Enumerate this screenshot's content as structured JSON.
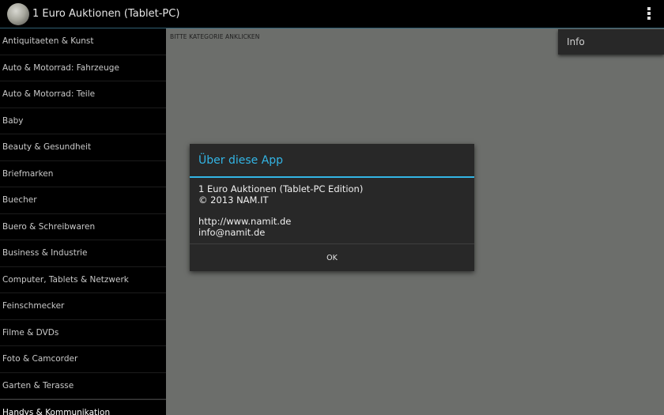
{
  "actionbar": {
    "title": "1 Euro Auktionen (Tablet-PC)",
    "logo_icon": "coin-icon",
    "overflow_icon": "overflow-menu-icon"
  },
  "sidebar": {
    "categories": [
      "Antiquitaeten & Kunst",
      "Auto & Motorrad: Fahrzeuge",
      "Auto & Motorrad: Teile",
      "Baby",
      "Beauty & Gesundheit",
      "Briefmarken",
      "Buecher",
      "Buero & Schreibwaren",
      "Business & Industrie",
      "Computer, Tablets & Netzwerk",
      "Feinschmecker",
      "Filme & DVDs",
      "Foto & Camcorder",
      "Garten & Terasse",
      "Handys & Kommunikation"
    ]
  },
  "main": {
    "hint": "BITTE KATEGORIE ANKLICKEN"
  },
  "menu": {
    "items": [
      "Info"
    ]
  },
  "dialog": {
    "title": "Über diese App",
    "lines": [
      "1 Euro Auktionen (Tablet-PC Edition)",
      "© 2013 NAM.IT",
      "",
      "http://www.namit.de",
      "info@namit.de"
    ],
    "ok_label": "OK"
  },
  "colors": {
    "accent": "#33b5e5",
    "main_background": "#6c6e6b",
    "dialog_background": "#282828"
  }
}
